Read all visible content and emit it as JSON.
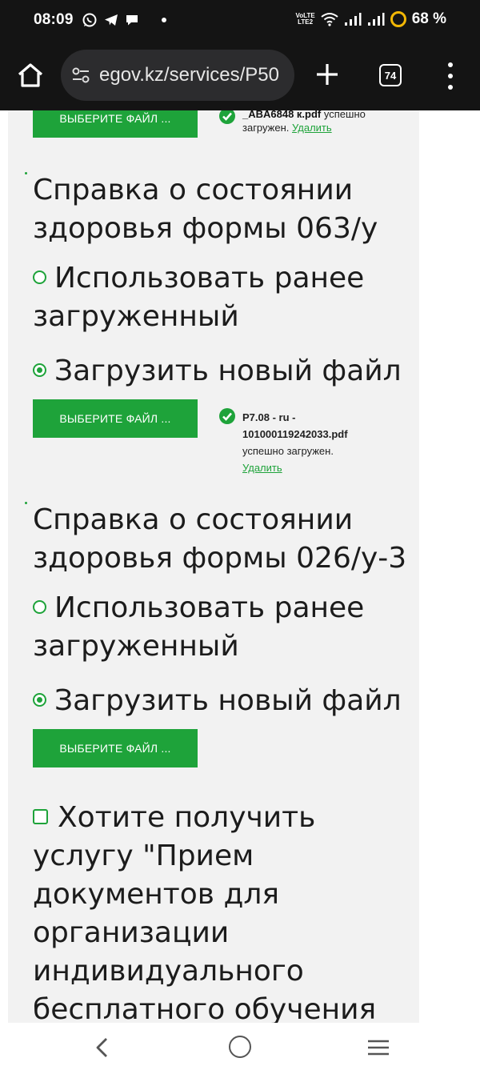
{
  "status_bar": {
    "time": "08:09",
    "volte_line1": "VoLTE",
    "volte_line2": "LTE2",
    "battery": "68 %"
  },
  "browser": {
    "url": "egov.kz/services/P50",
    "tab_count": "74"
  },
  "colors": {
    "accent": "#1ea33a",
    "panel": "#f2f2f2",
    "chrome": "#141414"
  },
  "top_upload": {
    "button_label": "ВЫБЕРИТЕ ФАЙЛ ...",
    "file_name": "_ABA6848 к.pdf",
    "success_text": "успешно",
    "success_text_2": "загружен.",
    "delete_label": "Удалить"
  },
  "section_063": {
    "title": "Справка о состоянии здоровья формы 063/у",
    "option_use_previous": "Использовать ранее загруженный",
    "option_upload_new": "Загрузить новый файл",
    "button_label": "ВЫБЕРИТЕ ФАЙЛ ...",
    "file_name_1": "P7.08 - ru -",
    "file_name_2": "101000119242033.pdf",
    "success_text": "успешно загружен.",
    "delete_label": "Удалить"
  },
  "section_026": {
    "title": "Справка о состоянии здоровья формы 026/у-3",
    "option_use_previous": "Использовать ранее загруженный",
    "option_upload_new": "Загрузить новый файл",
    "button_label": "ВЫБЕРИТЕ ФАЙЛ ..."
  },
  "extra_service": {
    "label": "Хотите получить услугу \"Прием документов для организации индивидуального бесплатного обучения на дому детей, которые по"
  }
}
